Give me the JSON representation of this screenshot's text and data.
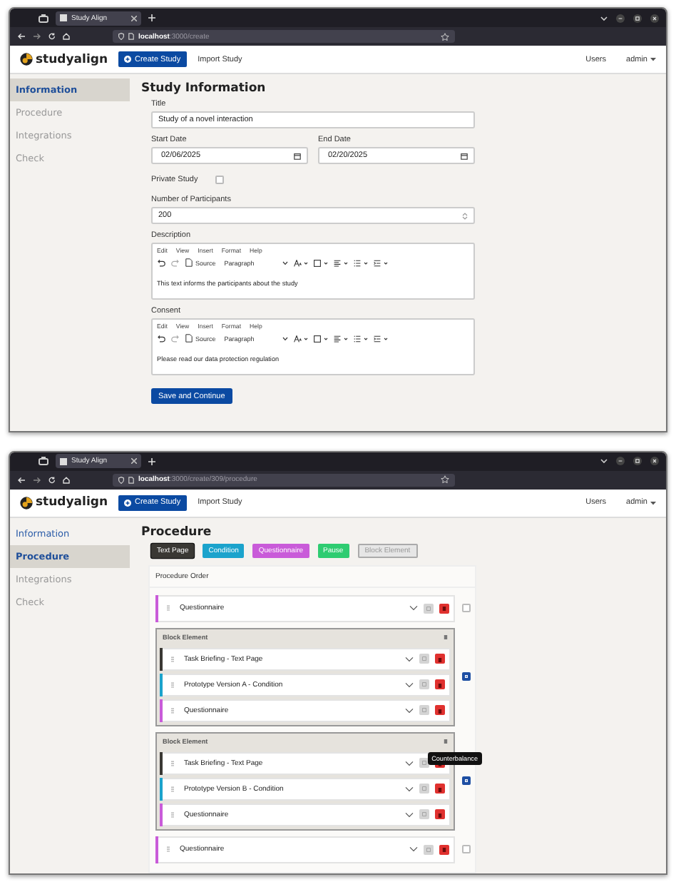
{
  "windows": [
    {
      "tab_title": "Study Align",
      "url": "**localhost**:3000/create",
      "app": {
        "logo": "studyalign",
        "create_button": "Create Study",
        "import_link": "Import Study",
        "users_link": "Users",
        "user_menu": "admin"
      },
      "sidebar": [
        {
          "label": "Information",
          "selected": true,
          "disabled": false
        },
        {
          "label": "Procedure",
          "selected": false,
          "disabled": true
        },
        {
          "label": "Integrations",
          "selected": false,
          "disabled": true
        },
        {
          "label": "Check",
          "selected": false,
          "disabled": true
        }
      ],
      "page": {
        "kind": "form",
        "heading": "Study Information",
        "fields": [
          {
            "kind": "text",
            "label": "Title",
            "value": "Study of a novel interaction"
          },
          {
            "kind": "dates",
            "items": [
              {
                "label": "Start Date",
                "value": "02/06/2025"
              },
              {
                "label": "End Date",
                "value": "02/20/2025"
              }
            ]
          },
          {
            "kind": "checkbox",
            "label": "Private Study",
            "checked": false
          },
          {
            "kind": "number",
            "label": "Number of Participants",
            "value": "200"
          },
          {
            "kind": "editor",
            "label": "Description",
            "menu": [
              "Edit",
              "View",
              "Insert",
              "Format",
              "Help"
            ],
            "source": "Source",
            "block_format": "Paragraph",
            "content": "This text informs the participants about the study"
          },
          {
            "kind": "editor",
            "label": "Consent",
            "menu": [
              "Edit",
              "View",
              "Insert",
              "Format",
              "Help"
            ],
            "source": "Source",
            "block_format": "Paragraph",
            "content": "Please read our data protection regulation"
          }
        ],
        "submit": "Save and Continue"
      }
    },
    {
      "tab_title": "Study Align",
      "url": "**localhost**:3000/create/309/procedure",
      "app": {
        "logo": "studyalign",
        "create_button": "Create Study",
        "import_link": "Import Study",
        "users_link": "Users",
        "user_menu": "admin"
      },
      "sidebar": [
        {
          "label": "Information",
          "selected": false,
          "disabled": false
        },
        {
          "label": "Procedure",
          "selected": true,
          "disabled": false
        },
        {
          "label": "Integrations",
          "selected": false,
          "disabled": true
        },
        {
          "label": "Check",
          "selected": false,
          "disabled": true
        }
      ],
      "page": {
        "kind": "procedure",
        "heading": "Procedure",
        "add_buttons": [
          {
            "kind": "solid",
            "label": "Text Page",
            "color": "#3a3834"
          },
          {
            "kind": "solid",
            "label": "Condition",
            "color": "#1ba3cc"
          },
          {
            "kind": "solid",
            "label": "Questionnaire",
            "color": "#c95bd9"
          },
          {
            "kind": "solid",
            "label": "Pause",
            "color": "#2ecc71"
          },
          {
            "kind": "outline",
            "label": "Block Element"
          }
        ],
        "order": {
          "title": "Procedure Order",
          "items": [
            {
              "kind": "step",
              "label": "Questionnaire",
              "color": "#c95bd9",
              "counterbalance": false
            },
            {
              "kind": "block",
              "title": "Block Element",
              "counterbalance": true,
              "children": [
                {
                  "label": "Task Briefing - Text Page",
                  "color": "#3a3834"
                },
                {
                  "label": "Prototype Version A - Condition",
                  "color": "#1ba3cc"
                },
                {
                  "label": "Questionnaire",
                  "color": "#c95bd9"
                }
              ]
            },
            {
              "kind": "block",
              "title": "Block Element",
              "counterbalance": true,
              "tooltip": "Counterbalance",
              "children": [
                {
                  "label": "Task Briefing - Text Page",
                  "color": "#3a3834"
                },
                {
                  "label": "Prototype Version B - Condition",
                  "color": "#1ba3cc"
                },
                {
                  "label": "Questionnaire",
                  "color": "#c95bd9"
                }
              ]
            },
            {
              "kind": "step",
              "label": "Questionnaire",
              "color": "#c95bd9",
              "counterbalance": false
            }
          ]
        }
      }
    }
  ]
}
